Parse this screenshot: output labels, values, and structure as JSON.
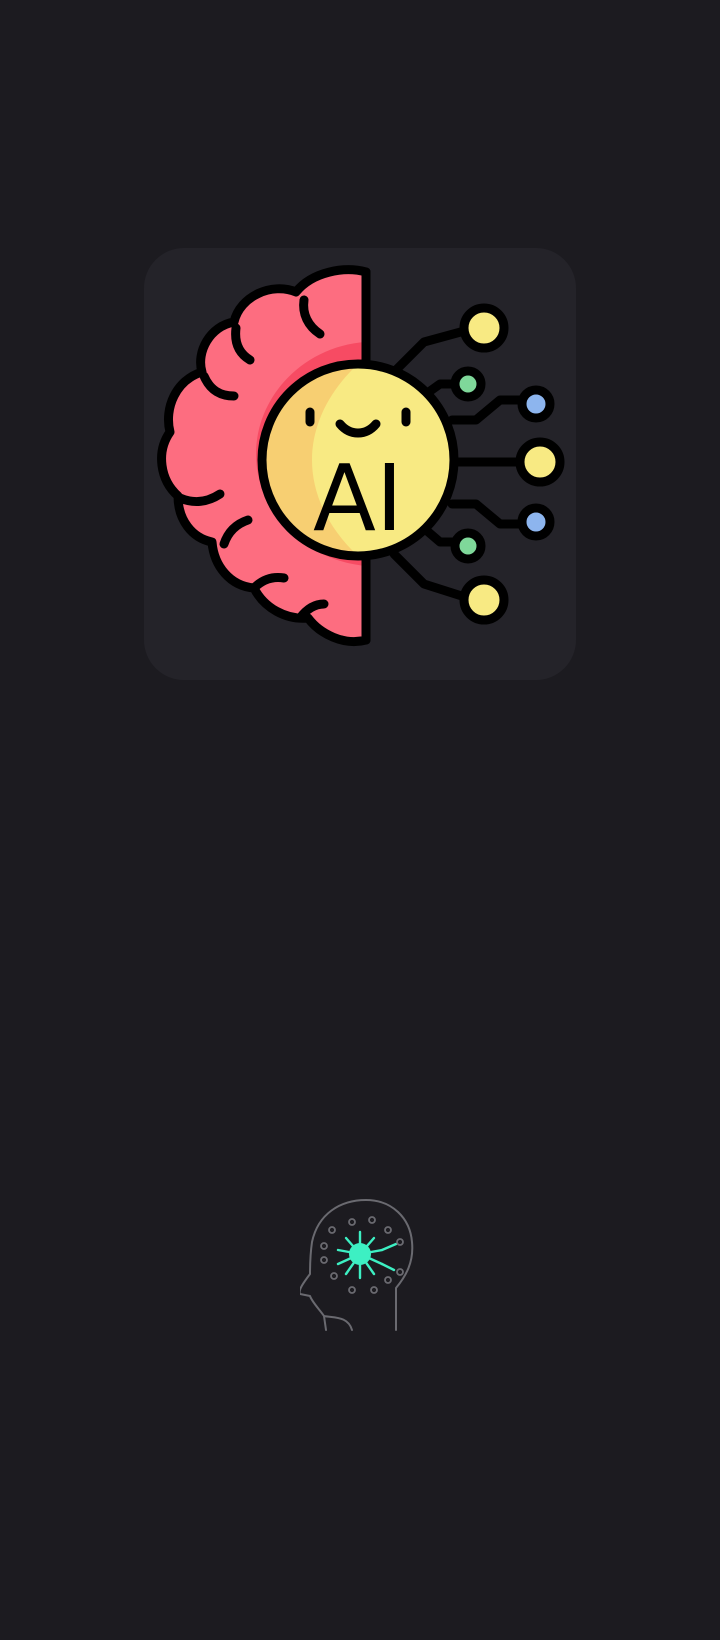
{
  "splash": {
    "app_icon": {
      "icon": "ai-brain-icon",
      "label": "AI",
      "colors": {
        "tile": "#242329",
        "brain": "#fd6d80",
        "brain_inner": "#f74b63",
        "face": "#f8ea83",
        "face_shade": "#f7cf72",
        "outline": "#000000",
        "node_yellow": "#f8ea83",
        "node_green": "#7fd89a",
        "node_blue": "#8db5ee"
      }
    },
    "brand_mark": {
      "icon": "head-circuit-icon",
      "colors": {
        "outline": "#6a6a70",
        "accent": "#3df0c3"
      }
    },
    "background": "#1c1b20"
  }
}
